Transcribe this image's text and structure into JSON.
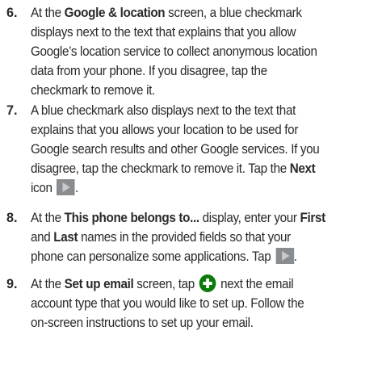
{
  "steps": [
    {
      "num": "6.",
      "lines": [
        [
          "At the ",
          {
            "b": "Google & location"
          },
          " screen, a blue checkmark"
        ],
        [
          "displays next to the text that explains that you allow"
        ],
        [
          "Google’s location service to collect anonymous location"
        ],
        [
          "data from your phone. If you disagree, tap the"
        ],
        [
          "checkmark to remove it."
        ]
      ]
    },
    {
      "num": "7.",
      "lines": [
        [
          "A blue checkmark also displays next to the text that"
        ],
        [
          "explains that you allows your location to be used for"
        ],
        [
          "Google search results and other Google services. If you"
        ],
        [
          "disagree, tap the checkmark to remove it. Tap the ",
          {
            "b": "Next"
          }
        ],
        [
          "icon ",
          {
            "icon": "next-icon"
          },
          "."
        ]
      ]
    },
    {
      "num": "8.",
      "lines": [
        [
          "At the ",
          {
            "b": "This phone belongs to..."
          },
          " display, enter your ",
          {
            "b": "First"
          }
        ],
        [
          "and ",
          {
            "b": "Last"
          },
          " names in the provided fields so that your"
        ],
        [
          "phone can personalize some applications. Tap ",
          {
            "icon": "next-icon"
          },
          "."
        ]
      ]
    },
    {
      "num": "9.",
      "lines": [
        [
          "At the ",
          {
            "b": "Set up email"
          },
          " screen, tap ",
          {
            "icon": "add-icon"
          },
          " next the email"
        ],
        [
          "account type that you would like to set up. Follow the"
        ],
        [
          "on-screen instructions to set up your email."
        ]
      ]
    }
  ],
  "colors": {
    "text": "#2a2a2a",
    "next_icon_bg": "#8a8d90",
    "add_icon_bg": "#0b7a0b"
  }
}
